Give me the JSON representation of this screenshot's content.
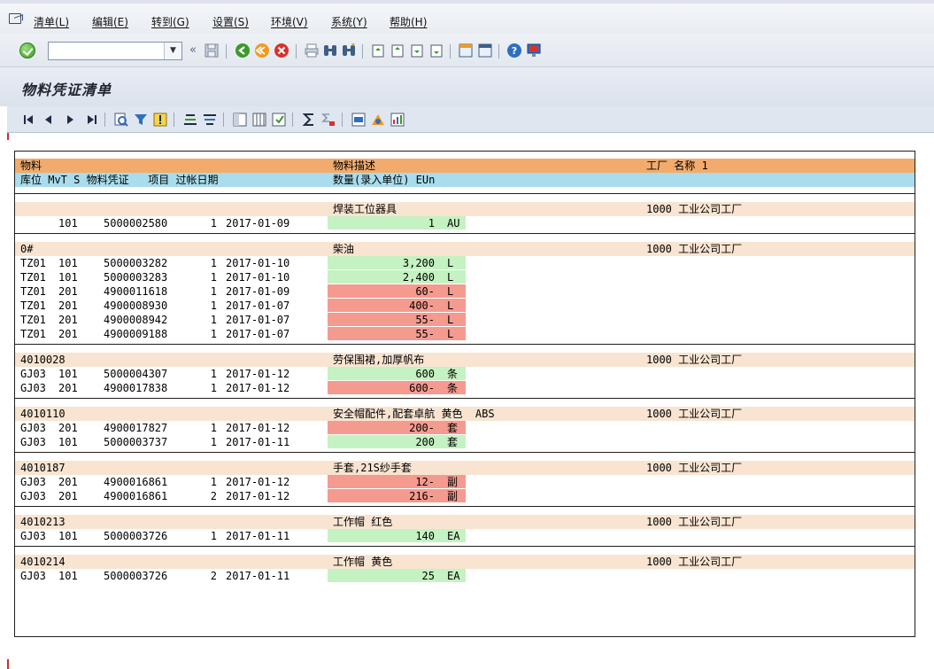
{
  "menu": {
    "items": [
      "清单(L)",
      "编辑(E)",
      "转到(G)",
      "设置(S)",
      "环境(V)",
      "系统(Y)",
      "帮助(H)"
    ]
  },
  "toolbar": {
    "command_value": "",
    "chevron": "«"
  },
  "title": "物料凭证清单",
  "list": {
    "header1": {
      "material": "物料",
      "desc": "物料描述",
      "plant": "工厂 名称 1"
    },
    "header2": {
      "cols": "库位 MvT S 物料凭证   项目 过帐日期",
      "qty": "数量(录入单位) EUn"
    },
    "groups": [
      {
        "material": "",
        "desc": "焊装工位器具",
        "plant": "1000 工业公司工厂",
        "lines": [
          {
            "sloc": "",
            "mvt": "101",
            "doc": "5000002580",
            "item": "1",
            "date": "2017-01-09",
            "qty": "1",
            "unit": "AU",
            "sign": "pos"
          }
        ]
      },
      {
        "material": "0#",
        "desc": "柴油",
        "plant": "1000 工业公司工厂",
        "lines": [
          {
            "sloc": "TZ01",
            "mvt": "101",
            "doc": "5000003282",
            "item": "1",
            "date": "2017-01-10",
            "qty": "3,200",
            "unit": "L",
            "sign": "pos"
          },
          {
            "sloc": "TZ01",
            "mvt": "101",
            "doc": "5000003283",
            "item": "1",
            "date": "2017-01-10",
            "qty": "2,400",
            "unit": "L",
            "sign": "pos"
          },
          {
            "sloc": "TZ01",
            "mvt": "201",
            "doc": "4900011618",
            "item": "1",
            "date": "2017-01-09",
            "qty": "60-",
            "unit": "L",
            "sign": "neg"
          },
          {
            "sloc": "TZ01",
            "mvt": "201",
            "doc": "4900008930",
            "item": "1",
            "date": "2017-01-07",
            "qty": "400-",
            "unit": "L",
            "sign": "neg"
          },
          {
            "sloc": "TZ01",
            "mvt": "201",
            "doc": "4900008942",
            "item": "1",
            "date": "2017-01-07",
            "qty": "55-",
            "unit": "L",
            "sign": "neg"
          },
          {
            "sloc": "TZ01",
            "mvt": "201",
            "doc": "4900009188",
            "item": "1",
            "date": "2017-01-07",
            "qty": "55-",
            "unit": "L",
            "sign": "neg"
          }
        ]
      },
      {
        "material": "4010028",
        "desc": "劳保围裙,加厚帆布",
        "plant": "1000 工业公司工厂",
        "lines": [
          {
            "sloc": "GJ03",
            "mvt": "101",
            "doc": "5000004307",
            "item": "1",
            "date": "2017-01-12",
            "qty": "600",
            "unit": "条",
            "sign": "pos"
          },
          {
            "sloc": "GJ03",
            "mvt": "201",
            "doc": "4900017838",
            "item": "1",
            "date": "2017-01-12",
            "qty": "600-",
            "unit": "条",
            "sign": "neg"
          }
        ]
      },
      {
        "material": "4010110",
        "desc": "安全帽配件,配套卓航 黄色  ABS",
        "plant": "1000 工业公司工厂",
        "lines": [
          {
            "sloc": "GJ03",
            "mvt": "201",
            "doc": "4900017827",
            "item": "1",
            "date": "2017-01-12",
            "qty": "200-",
            "unit": "套",
            "sign": "neg"
          },
          {
            "sloc": "GJ03",
            "mvt": "101",
            "doc": "5000003737",
            "item": "1",
            "date": "2017-01-11",
            "qty": "200",
            "unit": "套",
            "sign": "pos"
          }
        ]
      },
      {
        "material": "4010187",
        "desc": "手套,21S纱手套",
        "plant": "1000 工业公司工厂",
        "lines": [
          {
            "sloc": "GJ03",
            "mvt": "201",
            "doc": "4900016861",
            "item": "1",
            "date": "2017-01-12",
            "qty": "12-",
            "unit": "副",
            "sign": "neg"
          },
          {
            "sloc": "GJ03",
            "mvt": "201",
            "doc": "4900016861",
            "item": "2",
            "date": "2017-01-12",
            "qty": "216-",
            "unit": "副",
            "sign": "neg"
          }
        ]
      },
      {
        "material": "4010213",
        "desc": "工作帽 红色",
        "plant": "1000 工业公司工厂",
        "lines": [
          {
            "sloc": "GJ03",
            "mvt": "101",
            "doc": "5000003726",
            "item": "1",
            "date": "2017-01-11",
            "qty": "140",
            "unit": "EA",
            "sign": "pos"
          }
        ]
      },
      {
        "material": "4010214",
        "desc": "工作帽 黄色",
        "plant": "1000 工业公司工厂",
        "lines": [
          {
            "sloc": "GJ03",
            "mvt": "101",
            "doc": "5000003726",
            "item": "2",
            "date": "2017-01-11",
            "qty": "25",
            "unit": "EA",
            "sign": "pos"
          }
        ]
      }
    ]
  },
  "colors": {
    "header1": "#f2ab6c",
    "header2": "#a9dcec",
    "group": "#f8e4d1",
    "qty_positive": "#c5f2c2",
    "qty_negative": "#f59a8f"
  }
}
